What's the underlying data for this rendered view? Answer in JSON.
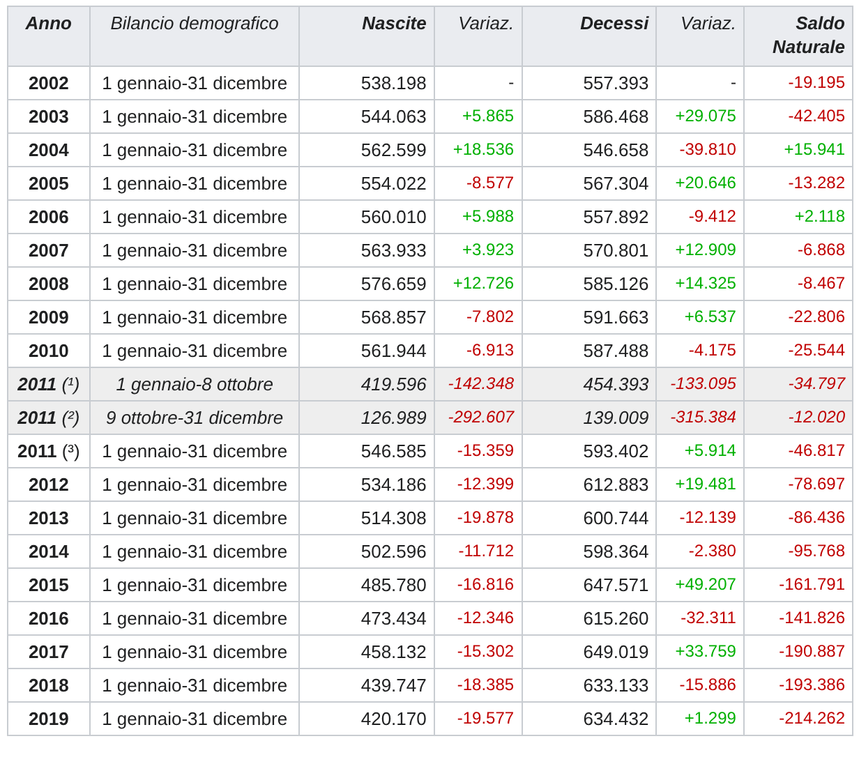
{
  "table": {
    "columns": [
      {
        "label": "Anno",
        "kind": "year"
      },
      {
        "label": "Bilancio demografico",
        "kind": "period"
      },
      {
        "label": "Nascite",
        "kind": "count"
      },
      {
        "label": "Variaz.",
        "kind": "change"
      },
      {
        "label": "Decessi",
        "kind": "count"
      },
      {
        "label": "Variaz.",
        "kind": "change"
      },
      {
        "label": "Saldo Naturale",
        "kind": "balance"
      }
    ],
    "rows": [
      {
        "year": "2002",
        "period": "1 gennaio-31 dicembre",
        "partial": false,
        "births": "538.198",
        "births_change": {
          "text": "-",
          "color": "#202122"
        },
        "deaths": "557.393",
        "deaths_change": {
          "text": "-",
          "color": "#202122"
        },
        "balance": {
          "text": "-19.195",
          "color": "#c00000"
        }
      },
      {
        "year": "2003",
        "period": "1 gennaio-31 dicembre",
        "partial": false,
        "births": "544.063",
        "births_change": {
          "text": "+5.865",
          "color": "#00b000"
        },
        "deaths": "586.468",
        "deaths_change": {
          "text": "+29.075",
          "color": "#00b000"
        },
        "balance": {
          "text": "-42.405",
          "color": "#c00000"
        }
      },
      {
        "year": "2004",
        "period": "1 gennaio-31 dicembre",
        "partial": false,
        "births": "562.599",
        "births_change": {
          "text": "+18.536",
          "color": "#00b000"
        },
        "deaths": "546.658",
        "deaths_change": {
          "text": "-39.810",
          "color": "#c00000"
        },
        "balance": {
          "text": "+15.941",
          "color": "#00b000"
        }
      },
      {
        "year": "2005",
        "period": "1 gennaio-31 dicembre",
        "partial": false,
        "births": "554.022",
        "births_change": {
          "text": "-8.577",
          "color": "#c00000"
        },
        "deaths": "567.304",
        "deaths_change": {
          "text": "+20.646",
          "color": "#00b000"
        },
        "balance": {
          "text": "-13.282",
          "color": "#c00000"
        }
      },
      {
        "year": "2006",
        "period": "1 gennaio-31 dicembre",
        "partial": false,
        "births": "560.010",
        "births_change": {
          "text": "+5.988",
          "color": "#00b000"
        },
        "deaths": "557.892",
        "deaths_change": {
          "text": "-9.412",
          "color": "#c00000"
        },
        "balance": {
          "text": "+2.118",
          "color": "#00b000"
        }
      },
      {
        "year": "2007",
        "period": "1 gennaio-31 dicembre",
        "partial": false,
        "births": "563.933",
        "births_change": {
          "text": "+3.923",
          "color": "#00b000"
        },
        "deaths": "570.801",
        "deaths_change": {
          "text": "+12.909",
          "color": "#00b000"
        },
        "balance": {
          "text": "-6.868",
          "color": "#c00000"
        }
      },
      {
        "year": "2008",
        "period": "1 gennaio-31 dicembre",
        "partial": false,
        "births": "576.659",
        "births_change": {
          "text": "+12.726",
          "color": "#00b000"
        },
        "deaths": "585.126",
        "deaths_change": {
          "text": "+14.325",
          "color": "#00b000"
        },
        "balance": {
          "text": "-8.467",
          "color": "#c00000"
        }
      },
      {
        "year": "2009",
        "period": "1 gennaio-31 dicembre",
        "partial": false,
        "births": "568.857",
        "births_change": {
          "text": "-7.802",
          "color": "#c00000"
        },
        "deaths": "591.663",
        "deaths_change": {
          "text": "+6.537",
          "color": "#00b000"
        },
        "balance": {
          "text": "-22.806",
          "color": "#c00000"
        }
      },
      {
        "year": "2010",
        "period": "1 gennaio-31 dicembre",
        "partial": false,
        "births": "561.944",
        "births_change": {
          "text": "-6.913",
          "color": "#c00000"
        },
        "deaths": "587.488",
        "deaths_change": {
          "text": "-4.175",
          "color": "#c00000"
        },
        "balance": {
          "text": "-25.544",
          "color": "#c00000"
        }
      },
      {
        "year": "2011",
        "note": "(¹)",
        "period": "1 gennaio-8 ottobre",
        "partial": true,
        "births": "419.596",
        "births_change": {
          "text": "-142.348",
          "color": "#c00000"
        },
        "deaths": "454.393",
        "deaths_change": {
          "text": "-133.095",
          "color": "#c00000"
        },
        "balance": {
          "text": "-34.797",
          "color": "#c00000"
        }
      },
      {
        "year": "2011",
        "note": "(²)",
        "period": "9 ottobre-31 dicembre",
        "partial": true,
        "births": "126.989",
        "births_change": {
          "text": "-292.607",
          "color": "#c00000"
        },
        "deaths": "139.009",
        "deaths_change": {
          "text": "-315.384",
          "color": "#c00000"
        },
        "balance": {
          "text": "-12.020",
          "color": "#c00000"
        }
      },
      {
        "year": "2011",
        "note": "(³)",
        "period": "1 gennaio-31 dicembre",
        "partial": false,
        "births": "546.585",
        "births_change": {
          "text": "-15.359",
          "color": "#c00000"
        },
        "deaths": "593.402",
        "deaths_change": {
          "text": "+5.914",
          "color": "#00b000"
        },
        "balance": {
          "text": "-46.817",
          "color": "#c00000"
        }
      },
      {
        "year": "2012",
        "period": "1 gennaio-31 dicembre",
        "partial": false,
        "births": "534.186",
        "births_change": {
          "text": "-12.399",
          "color": "#c00000"
        },
        "deaths": "612.883",
        "deaths_change": {
          "text": "+19.481",
          "color": "#00b000"
        },
        "balance": {
          "text": "-78.697",
          "color": "#c00000"
        }
      },
      {
        "year": "2013",
        "period": "1 gennaio-31 dicembre",
        "partial": false,
        "births": "514.308",
        "births_change": {
          "text": "-19.878",
          "color": "#c00000"
        },
        "deaths": "600.744",
        "deaths_change": {
          "text": "-12.139",
          "color": "#c00000"
        },
        "balance": {
          "text": "-86.436",
          "color": "#c00000"
        }
      },
      {
        "year": "2014",
        "period": "1 gennaio-31 dicembre",
        "partial": false,
        "births": "502.596",
        "births_change": {
          "text": "-11.712",
          "color": "#c00000"
        },
        "deaths": "598.364",
        "deaths_change": {
          "text": "-2.380",
          "color": "#c00000"
        },
        "balance": {
          "text": "-95.768",
          "color": "#c00000"
        }
      },
      {
        "year": "2015",
        "period": "1 gennaio-31 dicembre",
        "partial": false,
        "births": "485.780",
        "births_change": {
          "text": "-16.816",
          "color": "#c00000"
        },
        "deaths": "647.571",
        "deaths_change": {
          "text": "+49.207",
          "color": "#00b000"
        },
        "balance": {
          "text": "-161.791",
          "color": "#c00000"
        }
      },
      {
        "year": "2016",
        "period": "1 gennaio-31 dicembre",
        "partial": false,
        "births": "473.434",
        "births_change": {
          "text": "-12.346",
          "color": "#c00000"
        },
        "deaths": "615.260",
        "deaths_change": {
          "text": "-32.311",
          "color": "#c00000"
        },
        "balance": {
          "text": "-141.826",
          "color": "#c00000"
        }
      },
      {
        "year": "2017",
        "period": "1 gennaio-31 dicembre",
        "partial": false,
        "births": "458.132",
        "births_change": {
          "text": "-15.302",
          "color": "#c00000"
        },
        "deaths": "649.019",
        "deaths_change": {
          "text": "+33.759",
          "color": "#00b000"
        },
        "balance": {
          "text": "-190.887",
          "color": "#c00000"
        }
      },
      {
        "year": "2018",
        "period": "1 gennaio-31 dicembre",
        "partial": false,
        "births": "439.747",
        "births_change": {
          "text": "-18.385",
          "color": "#c00000"
        },
        "deaths": "633.133",
        "deaths_change": {
          "text": "-15.886",
          "color": "#c00000"
        },
        "balance": {
          "text": "-193.386",
          "color": "#c00000"
        }
      },
      {
        "year": "2019",
        "period": "1 gennaio-31 dicembre",
        "partial": false,
        "births": "420.170",
        "births_change": {
          "text": "-19.577",
          "color": "#c00000"
        },
        "deaths": "634.432",
        "deaths_change": {
          "text": "+1.299",
          "color": "#00b000"
        },
        "balance": {
          "text": "-214.262",
          "color": "#c00000"
        }
      }
    ]
  }
}
